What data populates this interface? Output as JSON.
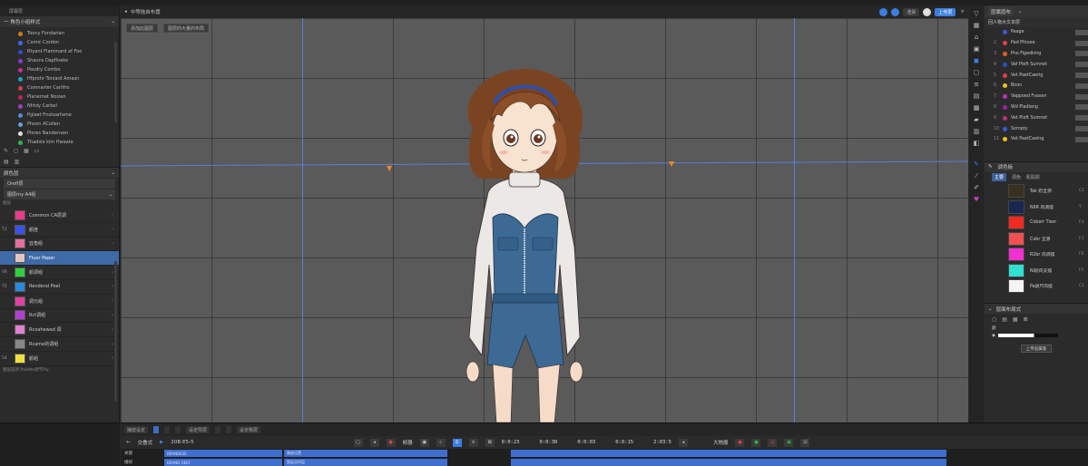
{
  "menubar": {
    "items": [
      "",
      "",
      "",
      "",
      "",
      "",
      "",
      ""
    ]
  },
  "left_panel": {
    "tabs": [
      "",
      "屏幕层"
    ],
    "header": "一 角色小组样式",
    "styles": [
      {
        "label": "Toony Fondarian",
        "color": "#d07a1a"
      },
      {
        "label": "Comic Cordon",
        "color": "#3a6ee8"
      },
      {
        "label": "Rtyant Flammard af Foo",
        "color": "#2a4ec8"
      },
      {
        "label": "Shauns Dapfloeke",
        "color": "#8a3ad8"
      },
      {
        "label": "Poudry Combo",
        "color": "#c0309a"
      },
      {
        "label": "Hfprohr Toniard Amasn",
        "color": "#20a0c8"
      },
      {
        "label": "Comnarter Carilfro",
        "color": "#d04050"
      },
      {
        "label": "Planernat Nosian",
        "color": "#c02060"
      },
      {
        "label": "Nhtdy Carbel",
        "color": "#a040c0"
      },
      {
        "label": "Pgiaet Fnotsarfame",
        "color": "#5a8ad8"
      },
      {
        "label": "Phoon ACollen",
        "color": "#6aa0e0"
      },
      {
        "label": "Plores Nandenven",
        "color": "#e0e0e0"
      },
      {
        "label": "Thadsle kim Hwaate",
        "color": "#3ab050"
      }
    ],
    "section_title": "颜色层",
    "dropdown1": "Oreft层",
    "dropdown2": "图层rny A4组",
    "layers_label": "图层",
    "layers": [
      {
        "num": "",
        "name": "Common CA层调",
        "color": "#e83a8a"
      },
      {
        "num": "T3",
        "name": "颜度",
        "color": "#3a50e8"
      },
      {
        "num": "",
        "name": "亚角组",
        "color": "#e070a0"
      },
      {
        "num": "",
        "name": "Fluer Peper",
        "color": "#e0c8c0",
        "selected": true
      },
      {
        "num": "06",
        "name": "颜调组",
        "color": "#30d040"
      },
      {
        "num": "T5",
        "name": "Rendend Peel",
        "color": "#2a8ae0"
      },
      {
        "num": "",
        "name": "调元组",
        "color": "#e040a0"
      },
      {
        "num": "",
        "name": "Rct调组",
        "color": "#b040d0"
      },
      {
        "num": "",
        "name": "Rcoahewad 调",
        "color": "#e080d0"
      },
      {
        "num": "",
        "name": "Rcame的调组",
        "color": "#888888"
      },
      {
        "num": "54",
        "name": "颜组",
        "color": "#f0e040"
      }
    ],
    "footer": "图层选项 Palette调节Ply"
  },
  "viewport": {
    "title": "中等拖自布置",
    "btn_blue": "",
    "btn_render": "渲染",
    "btn_save": "上传层",
    "sub_btn1": "添加此图层",
    "sub_btn2": "图层的大量的布局"
  },
  "right_panel": {
    "header": "层属层布",
    "sub": "回人物大文本层",
    "tree": [
      {
        "n": "",
        "label": "Paage",
        "color": "#3a5ae0",
        "badge": ""
      },
      {
        "n": "2",
        "label": "Pad Pfooee",
        "color": "#e04040",
        "badge": ""
      },
      {
        "n": "3",
        "label": "Pno Figedking",
        "color": "#e06020",
        "badge": ""
      },
      {
        "n": "4",
        "label": "Vaf Pleft Sumnet",
        "color": "#2a50c0",
        "badge": ""
      },
      {
        "n": "5",
        "label": "Vet PaetCaerig",
        "color": "#e04040",
        "badge": ""
      },
      {
        "n": "6",
        "label": "Boon",
        "color": "#f0c020",
        "badge": ""
      },
      {
        "n": "7",
        "label": "Vappoed Fvasen",
        "color": "#c030c0",
        "badge": ""
      },
      {
        "n": "8",
        "label": "Wd Pladlang",
        "color": "#a020a0",
        "badge": ""
      },
      {
        "n": "9",
        "label": "Vet Pleft Sumnet",
        "color": "#c03080",
        "badge": ""
      },
      {
        "n": "10",
        "label": "Sompty",
        "color": "#3a5ae0",
        "badge": ""
      },
      {
        "n": "11",
        "label": "Vat PaetCaeing",
        "color": "#f0c020",
        "badge": ""
      }
    ],
    "swatch_header": "调色板",
    "swatch_tabs": [
      "主要",
      "调色",
      "肌肤颜"
    ],
    "swatches": [
      {
        "label": "Tak 奶全源",
        "color": "#3a3020",
        "key": "C1"
      },
      {
        "label": "N6R 肉调摆",
        "color": "#1a2650",
        "key": "Y"
      },
      {
        "label": "Coberr Tiser",
        "color": "#f02a20",
        "key": "F4"
      },
      {
        "label": "Cobr 全源",
        "color": "#f05050",
        "key": "F3"
      },
      {
        "label": "R2br 肉调摆",
        "color": "#f030d0",
        "key": "F6"
      },
      {
        "label": "NI颜肉支摆",
        "color": "#30e0d0",
        "key": "F5"
      },
      {
        "label": "Pa颜尺肉摆",
        "color": "#f4f4f4",
        "key": "C1"
      }
    ],
    "section2": "层面布局式",
    "opacity_label": "颜",
    "apply_btn": "上传层属素"
  },
  "timeline": {
    "tools": [
      "播放设定",
      "",
      "",
      "",
      "设定导层",
      "",
      "",
      "设定移层"
    ],
    "head_label": "交叠式",
    "frame_range": "20B-E5-5",
    "labels_mid": "帧器",
    "times": [
      "0:0:23",
      "0:0:30",
      "0:0:03",
      "0:0:15",
      "2:03:5"
    ],
    "right_label": "大物展",
    "tracks": [
      {
        "name": "关键",
        "clips": [
          "BRANDESE",
          "播放设置",
          ""
        ]
      },
      {
        "name": "播帧",
        "clips": [
          "BRAND OEEF",
          "图层设的层",
          ""
        ]
      }
    ]
  }
}
